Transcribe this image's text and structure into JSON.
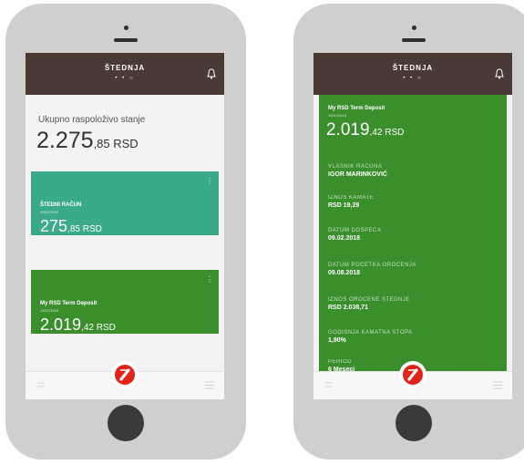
{
  "app": {
    "title": "ŠTEDNJA",
    "pager": "• • ○"
  },
  "left": {
    "total_label": "Ukupno raspoloživo stanje",
    "total_int": "2.275",
    "total_dec": ",85 RSD",
    "cards": [
      {
        "title": "ŠTEDNI RAČUN",
        "number": "195137818",
        "amount_int": "275",
        "amount_dec": ",85  RSD"
      },
      {
        "title": "My RSD Term Deposit",
        "number": "195123818",
        "amount_int": "2.019",
        "amount_dec": ",42  RSD"
      }
    ]
  },
  "right": {
    "title": "My RSD Term Deposit",
    "number": "195123818",
    "amount_int": "2.019",
    "amount_dec": ",42  RSD",
    "fields": [
      {
        "label": "VLASNIK RAČUNA",
        "value": "IGOR MARINKOVIĆ"
      },
      {
        "label": "IZNOS KAMATE",
        "value": "RSD 19,29"
      },
      {
        "label": "DATUM DOSPEĆA",
        "value": "09.02.2018"
      },
      {
        "label": "DATUM POČETKA OROČENJA",
        "value": "09.08.2018"
      },
      {
        "label": "IZNOS OROČENE ŠTEDNJE",
        "value": "RSD 2.038,71"
      },
      {
        "label": "GODIŠNJA KAMATNA STOPA",
        "value": "1,90%"
      },
      {
        "label": "PERIOD",
        "value": "6 Meseci"
      }
    ]
  },
  "colors": {
    "header": "#4a3a36",
    "teal_card": "#3aaa8a",
    "green_card": "#3a8f2c",
    "logo_red": "#e2231a"
  },
  "icons": [
    "bell-icon",
    "menu-icon",
    "back-icon",
    "unicredit-logo-icon"
  ]
}
